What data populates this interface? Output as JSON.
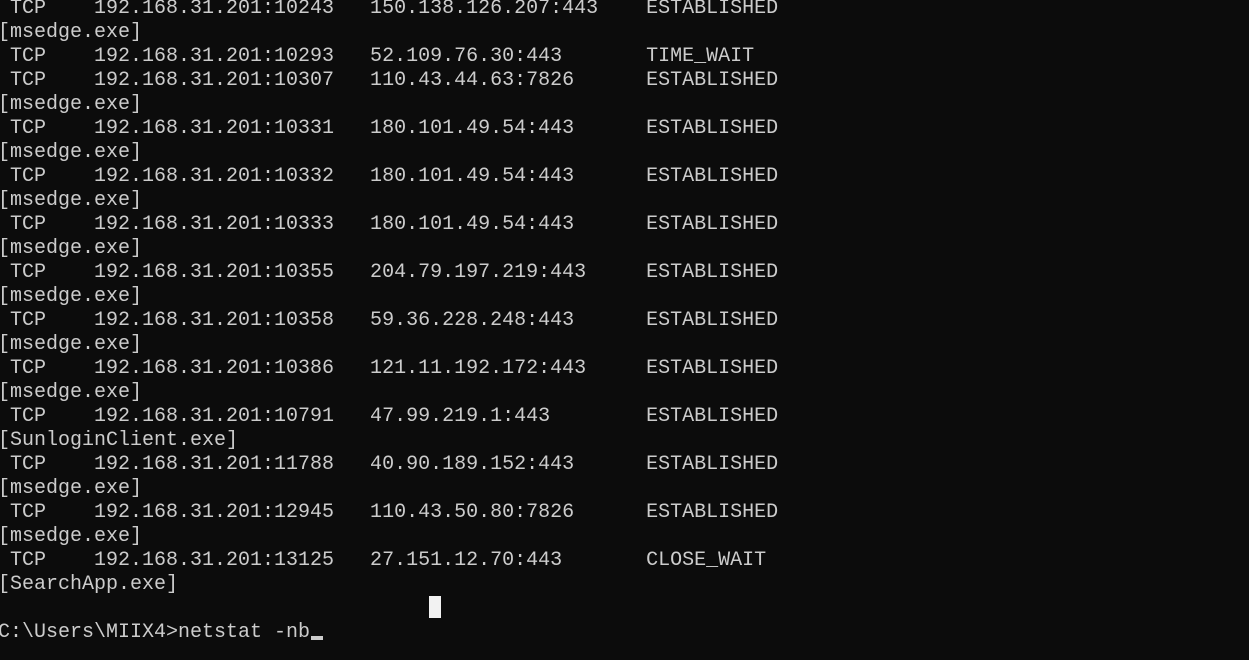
{
  "terminal": {
    "background": "#0c0c0c",
    "foreground": "#cccccc",
    "lines": [
      " TCP    192.168.31.201:10243   150.138.126.207:443    ESTABLISHED",
      "[msedge.exe]",
      " TCP    192.168.31.201:10293   52.109.76.30:443       TIME_WAIT",
      " TCP    192.168.31.201:10307   110.43.44.63:7826      ESTABLISHED",
      "[msedge.exe]",
      " TCP    192.168.31.201:10331   180.101.49.54:443      ESTABLISHED",
      "[msedge.exe]",
      " TCP    192.168.31.201:10332   180.101.49.54:443      ESTABLISHED",
      "[msedge.exe]",
      " TCP    192.168.31.201:10333   180.101.49.54:443      ESTABLISHED",
      "[msedge.exe]",
      " TCP    192.168.31.201:10355   204.79.197.219:443     ESTABLISHED",
      "[msedge.exe]",
      " TCP    192.168.31.201:10358   59.36.228.248:443      ESTABLISHED",
      "[msedge.exe]",
      " TCP    192.168.31.201:10386   121.11.192.172:443     ESTABLISHED",
      "[msedge.exe]",
      " TCP    192.168.31.201:10791   47.99.219.1:443        ESTABLISHED",
      "[SunloginClient.exe]",
      " TCP    192.168.31.201:11788   40.90.189.152:443      ESTABLISHED",
      "[msedge.exe]",
      " TCP    192.168.31.201:12945   110.43.50.80:7826      ESTABLISHED",
      "[msedge.exe]",
      " TCP    192.168.31.201:13125   27.151.12.70:443       CLOSE_WAIT",
      "[SearchApp.exe]",
      ""
    ],
    "prompt": "C:\\Users\\MIIX4>",
    "command": "netstat -nb"
  }
}
